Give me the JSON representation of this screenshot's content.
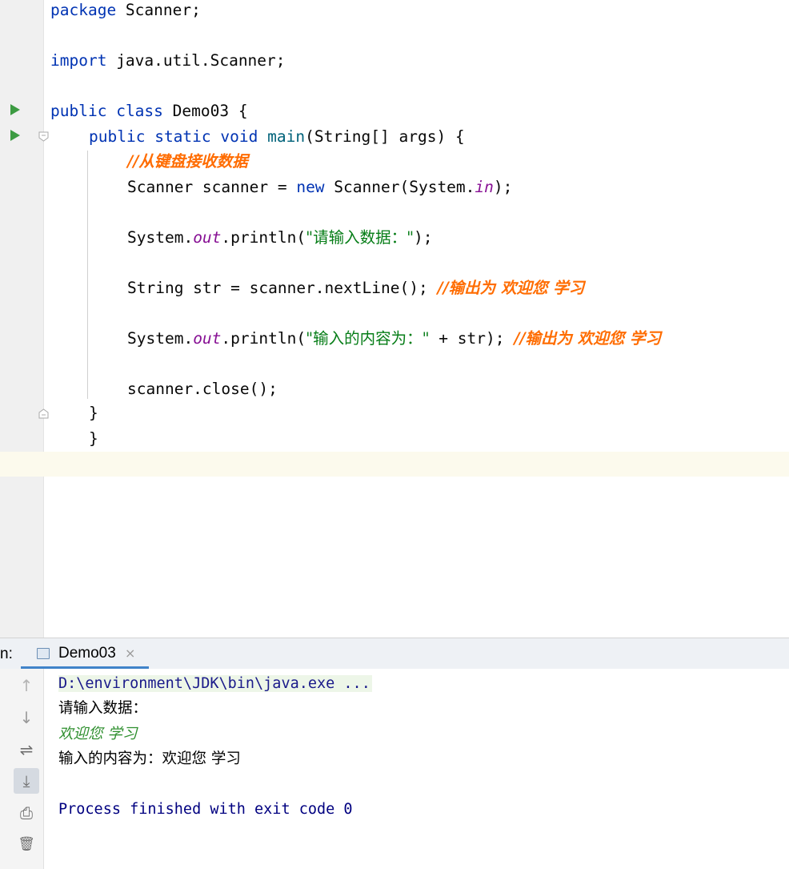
{
  "editor": {
    "lines": {
      "l1": {
        "kw": "package",
        "rest": " Scanner;"
      },
      "l3": {
        "kw": "import",
        "rest": " java.util.Scanner;"
      },
      "l5": {
        "kw1": "public",
        "kw2": "class",
        "rest": " Demo03 {"
      },
      "l6": {
        "kw1": "public",
        "kw2": "static",
        "kw3": "void",
        "fn": "main",
        "rest": "(String[] args) {"
      },
      "l7": {
        "comment": "//从键盘接收数据"
      },
      "l8": {
        "pre": "Scanner scanner = ",
        "kw": "new",
        "mid": " Scanner(System.",
        "field": "in",
        "post": ");"
      },
      "l10": {
        "pre": "System.",
        "field": "out",
        "mid": ".println(",
        "str": "\"请输入数据：\"",
        "post": ");"
      },
      "l12": {
        "pre": "String str = scanner.nextLine(); ",
        "comment": "//输出为 欢迎您 学习"
      },
      "l14": {
        "pre": "System.",
        "field": "out",
        "mid": ".println(",
        "str": "\"输入的内容为：\"",
        "post": " + str); ",
        "comment": "//输出为 欢迎您 学习"
      },
      "l16": {
        "text": "scanner.close();"
      },
      "l17": {
        "text": "}"
      },
      "l18": {
        "text": "}"
      }
    }
  },
  "run_panel": {
    "label": "n:",
    "tab_title": "Demo03",
    "close_glyph": "×",
    "console": {
      "command": "D:\\environment\\JDK\\bin\\java.exe ...",
      "prompt": "请输入数据：",
      "user_input": "欢迎您 学习",
      "output": "输入的内容为：欢迎您 学习",
      "exit_message": "Process finished with exit code 0"
    },
    "tools": [
      "up-arrow-icon",
      "down-arrow-icon",
      "soft-wrap-icon",
      "scroll-to-end-icon",
      "print-icon",
      "trash-icon"
    ],
    "tool_glyphs": {
      "up": "↑",
      "down": "↓",
      "wrap": "⇌",
      "scroll": "⤓",
      "print": "⎙",
      "trash": "🗑"
    }
  },
  "colors": {
    "keyword": "#0033b3",
    "method": "#00627a",
    "string": "#067d17",
    "field": "#871094",
    "comment": "#ff6c00",
    "run_icon": "#3c9b42",
    "tab_underline": "#4083c9"
  }
}
